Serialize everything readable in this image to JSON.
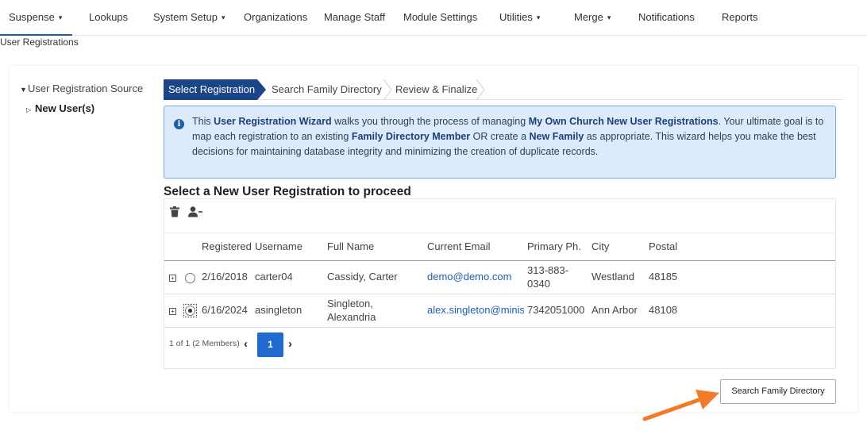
{
  "nav": {
    "items": [
      {
        "label": "Suspense",
        "caret": "▾",
        "active": true
      },
      {
        "label": "Lookups"
      },
      {
        "label": "System Setup",
        "caret": "▾"
      },
      {
        "label": "Organizations"
      },
      {
        "label": "Manage Staff"
      },
      {
        "label": "Module Settings"
      },
      {
        "label": "Utilities",
        "caret": "▾"
      },
      {
        "label": "Merge",
        "caret": "▾"
      },
      {
        "label": "Notifications"
      },
      {
        "label": "Reports"
      }
    ]
  },
  "breadcrumb": "User Registrations",
  "tree": {
    "root_label": "User Registration Source",
    "child_label": "New User(s)"
  },
  "wizard": {
    "steps": [
      "Select Registration",
      "Search Family Directory",
      "Review & Finalize"
    ]
  },
  "info": {
    "icon": "info-circle-icon",
    "parts": {
      "t1": "This ",
      "b1": "User Registration Wizard",
      "t2": " walks you through the process of managing ",
      "b2": "My Own Church New User Registrations",
      "t3": ". Your ultimate goal is to map each registration to an existing ",
      "b3": "Family Directory Member",
      "t4": " OR create a ",
      "b4": "New Family",
      "t5": " as appropriate. This wizard helps you make the best decisions for maintaining database integrity and minimizing the creation of duplicate records."
    }
  },
  "section_title": "Select a New User Registration to proceed",
  "grid": {
    "toolbar": [
      "trash-icon",
      "remove-user-icon"
    ],
    "columns": [
      "Registered",
      "Username",
      "Full Name",
      "Current Email",
      "Primary Ph.",
      "City",
      "Postal"
    ],
    "rows": [
      {
        "registered": "2/16/2018",
        "username": "carter04",
        "full_name": "Cassidy, Carter",
        "email": "demo@demo.com",
        "phone": "313-883-0340",
        "city": "Westland",
        "postal": "48185",
        "selected": false
      },
      {
        "registered": "6/16/2024",
        "username": "asingleton",
        "full_name": "Singleton, Alexandria",
        "email": "alex.singleton@minist",
        "phone": "7342051000",
        "city": "Ann Arbor",
        "postal": "48108",
        "selected": true
      }
    ],
    "pager": {
      "info": "1 of 1 (2 Members)",
      "current_page": "1",
      "prev": "‹",
      "next": "›"
    }
  },
  "actions": {
    "search_family_directory": "Search Family Directory"
  },
  "colors": {
    "accent": "#1c4587",
    "page_button": "#1f6bd0",
    "info_bg": "#dcebfb",
    "arrow": "#f07b28"
  }
}
